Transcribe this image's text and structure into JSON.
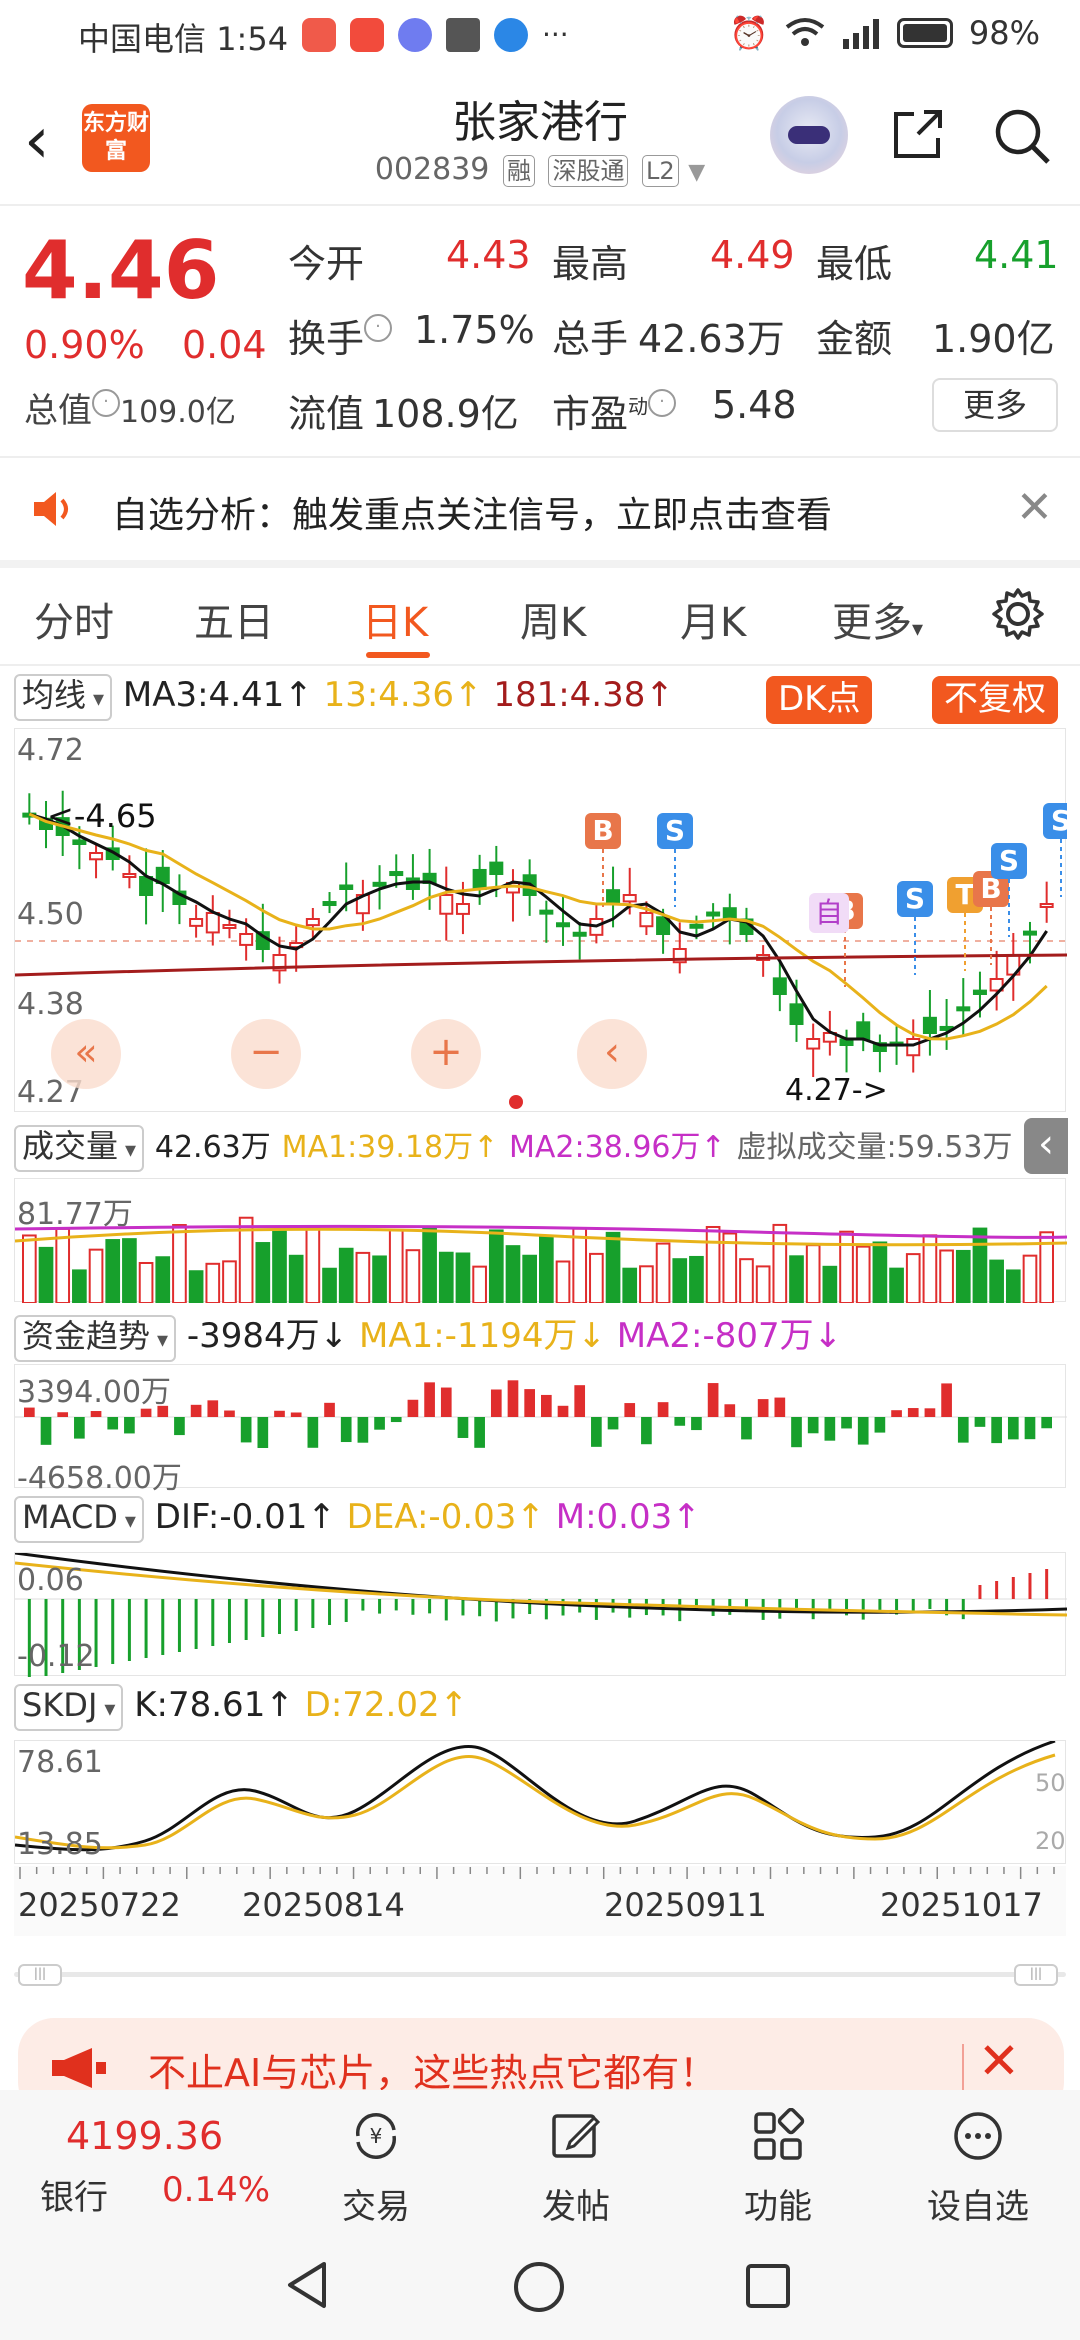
{
  "status_bar": {
    "carrier": "中国电信",
    "time": "1:54",
    "battery": "98%",
    "more": "···"
  },
  "header": {
    "title": "张家港行",
    "code": "002839",
    "tags": [
      "融",
      "深股通",
      "L2"
    ],
    "logo_text": "东方财富"
  },
  "quote": {
    "price": "4.46",
    "change_pct": "0.90%",
    "change": "0.04",
    "fields": [
      {
        "label": "今开",
        "value": "4.43"
      },
      {
        "label": "最高",
        "value": "4.49"
      },
      {
        "label": "最低",
        "value": "4.41"
      },
      {
        "label": "换手",
        "value": "1.75%"
      },
      {
        "label": "总手",
        "value": "42.63万"
      },
      {
        "label": "金额",
        "value": "1.90亿"
      },
      {
        "label": "流值",
        "value": "108.9亿"
      },
      {
        "label": "市盈",
        "value": "5.48"
      }
    ],
    "market_cap_label": "总值",
    "market_cap": "109.0亿",
    "pe_superscript": "动",
    "more_button": "更多"
  },
  "alert": {
    "text": "自选分析：触发重点关注信号，立即点击查看"
  },
  "tabs": [
    "分时",
    "五日",
    "日K",
    "周K",
    "月K",
    "更多"
  ],
  "active_tab": "日K",
  "kline": {
    "selector": "均线",
    "ma3": "MA3:4.41",
    "ma13": "13:4.36",
    "ma181": "181:4.38",
    "dk_button": "DK点",
    "adjust_button": "不复权",
    "y_labels": [
      "4.72",
      "4.50",
      "4.38",
      "4.27"
    ],
    "max_marker": "<-4.65",
    "min_marker": "4.27->",
    "signal_self": "自"
  },
  "volume": {
    "selector": "成交量",
    "value": "42.63万",
    "ma1": "MA1:39.18万",
    "ma2": "MA2:38.96万",
    "virtual": "虚拟成交量:59.53万",
    "y_label": "81.77万"
  },
  "fund": {
    "selector": "资金趋势",
    "value": "-3984万",
    "ma1": "MA1:-1194万",
    "ma2": "MA2:-807万",
    "y_top": "3394.00万",
    "y_bottom": "-4658.00万"
  },
  "macd": {
    "selector": "MACD",
    "dif": "DIF:-0.01",
    "dea": "DEA:-0.03",
    "m": "M:0.03",
    "y_top": "0.06",
    "y_bottom": "-0.12"
  },
  "skdj": {
    "selector": "SKDJ",
    "k": "K:78.61",
    "d": "D:72.02",
    "y_top": "78.61",
    "y_bottom": "13.85",
    "ref_50": "50",
    "ref_20": "20"
  },
  "dates": [
    "20250722",
    "20250814",
    "20250911",
    "20251017"
  ],
  "promo": {
    "text": "不止AI与芯片，这些热点它都有！"
  },
  "bottom_nav": {
    "index_value": "4199.36",
    "index_label": "银行",
    "index_change": "0.14%",
    "items": [
      "交易",
      "发帖",
      "功能",
      "设自选"
    ]
  },
  "colors": {
    "accent": "#f2581f",
    "up": "#e02d2d",
    "down": "#17a02c",
    "ma13": "#e8b21a",
    "ma181": "#a31c1c",
    "macd_dea": "#e8b21a",
    "pink": "#c62fc6"
  }
}
